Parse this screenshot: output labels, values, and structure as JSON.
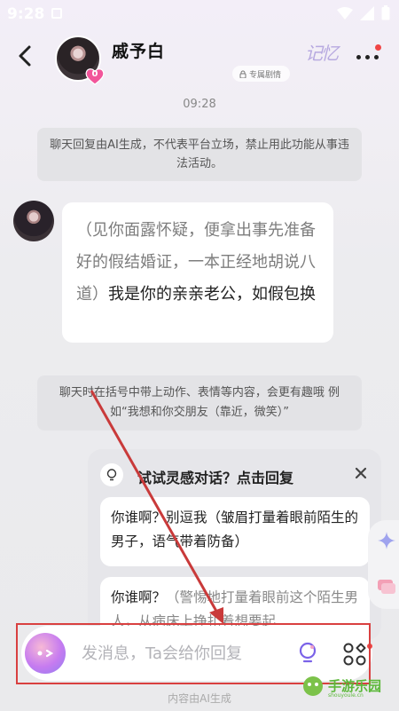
{
  "status_bar": {
    "time": "9:28"
  },
  "header": {
    "name": "戚予白",
    "heart_count": "0",
    "exclusive_tag": "专属剧情",
    "memory_label": "记忆"
  },
  "chat": {
    "timestamp": "09:28",
    "system_notice": "聊天回复由AI生成，不代表平台立场，禁止用此功能从事违法活动。",
    "message": {
      "action_text": "（见你面露怀疑，便拿出事先准备好的假结婚证，一本正经地胡说八道）",
      "speech_text": "我是你的亲亲老公，如假包换"
    },
    "hint_notice": "聊天时在括号中带上动作、表情等内容，会更有趣哦 例如“我想和你交朋友（靠近，微笑）”"
  },
  "inspiration": {
    "title": "试试灵感对话？点击回复",
    "options": [
      {
        "speech": "你谁啊？别逗我",
        "action": "（皱眉打量着眼前陌生的男子，语气带着防备）"
      },
      {
        "speech": "你谁啊？",
        "action": "（警惕地打量着眼前这个陌生男人，从病床上挣扎着想要起"
      }
    ]
  },
  "input_bar": {
    "placeholder": "发消息，Ta会给你回复"
  },
  "footnote": "内容由AI生成",
  "watermark": {
    "text": "手游乐园",
    "sub": "shouyoule.cn"
  },
  "colors": {
    "accent_red": "#d94040",
    "heart_pink": "#f2559a",
    "bubble": "#ffffff"
  }
}
